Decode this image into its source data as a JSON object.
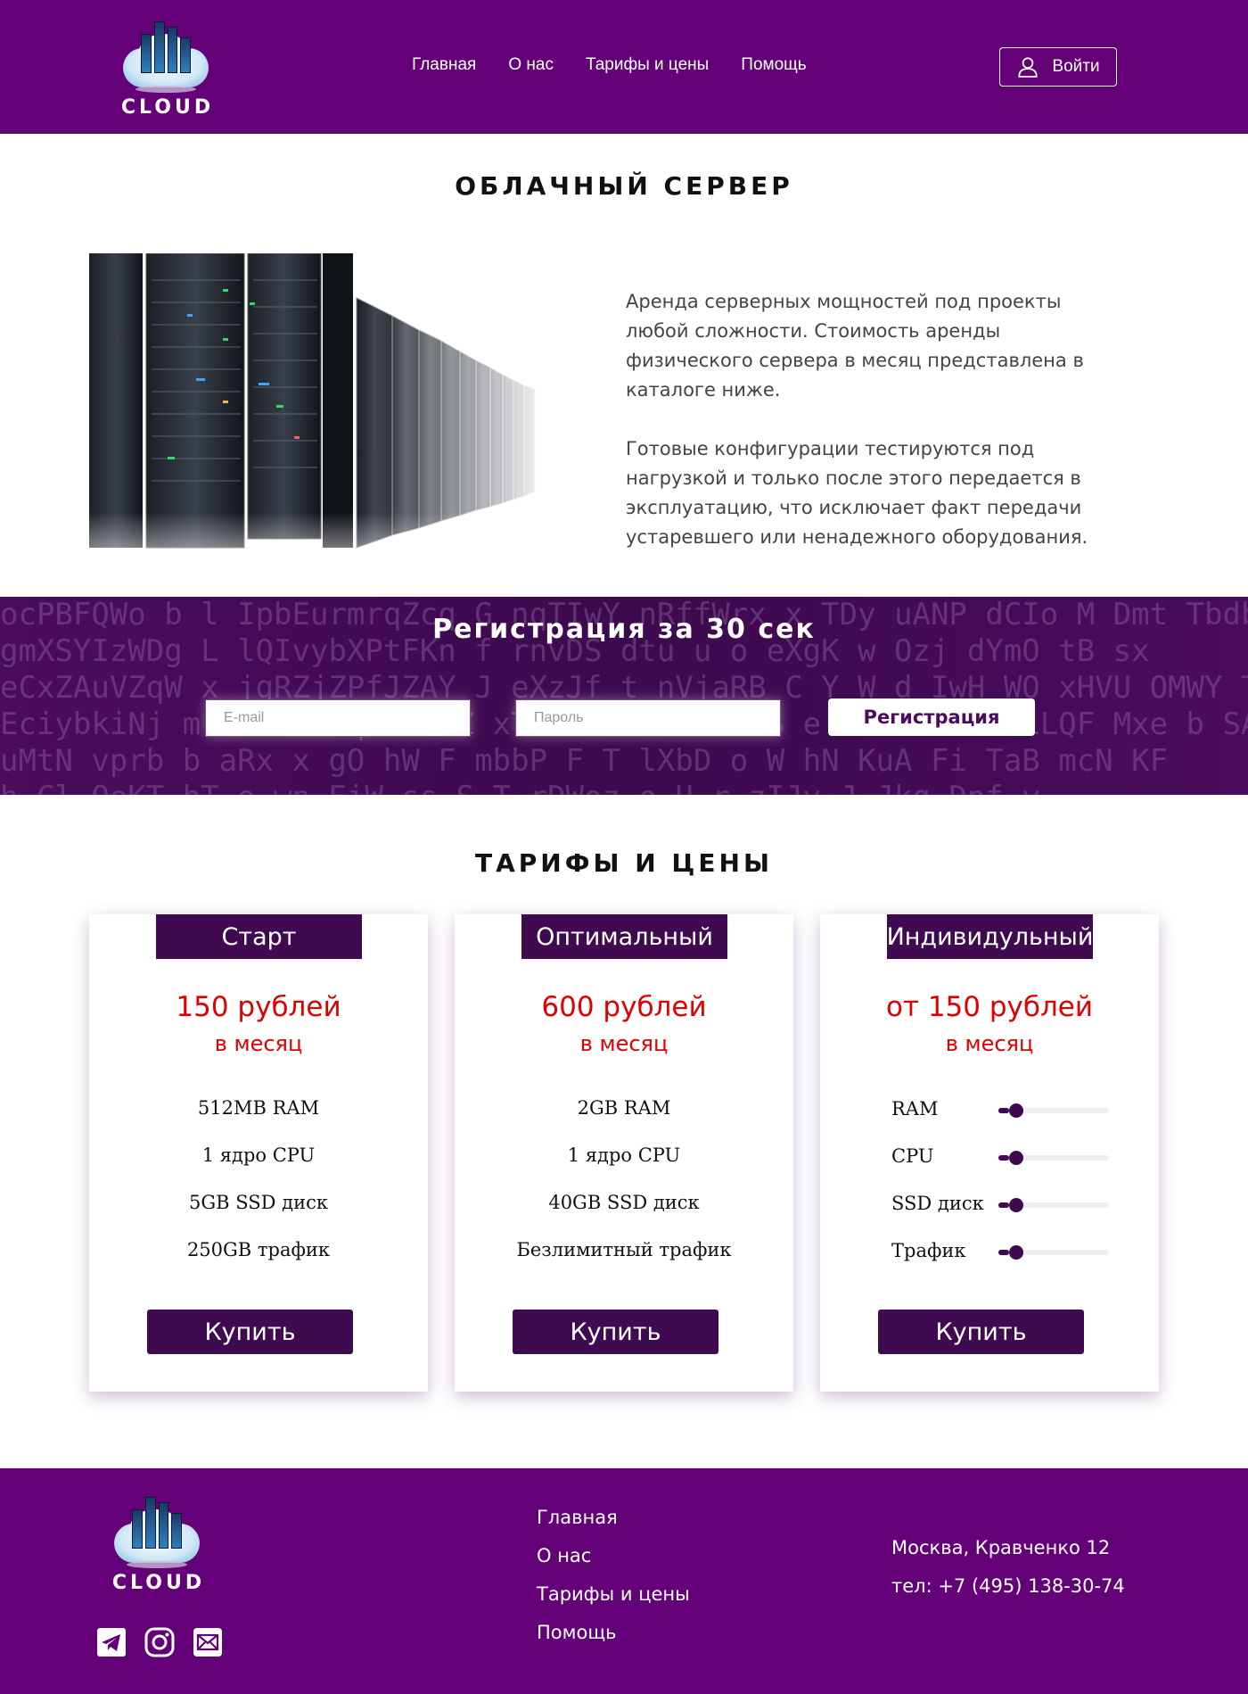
{
  "colors": {
    "brand": "#640078",
    "dark": "#3f0a4f",
    "price": "#e00000"
  },
  "brand": {
    "logo_text": "CLOUD"
  },
  "nav": {
    "items": [
      "Главная",
      "О нас",
      "Тарифы и цены",
      "Помощь"
    ],
    "login_label": "Войти"
  },
  "hero": {
    "title": "ОБЛАЧНЫЙ СЕРВЕР",
    "paragraph_1": "Аренда серверных мощностей под проекты любой сложности. Стоимость аренды физического сервера в месяц представлена в каталоге ниже.",
    "paragraph_2": "Готовые конфигурации тестируются под нагрузкой и только после этого передается в эксплуатацию, что исключает факт передачи устаревшего или ненадежного оборудования."
  },
  "registration": {
    "title": "Регистрация за 30 сек",
    "email_placeholder": "E-mail",
    "password_placeholder": "Пароль",
    "submit_label": "Регистрация"
  },
  "pricing": {
    "title": "ТАРИФЫ И ЦЕНЫ",
    "plans": [
      {
        "name": "Старт",
        "price": "150 рублей",
        "period": "в месяц",
        "features": [
          "512MB RAM",
          "1 ядро CPU",
          "5GB SSD диск",
          "250GB трафик"
        ],
        "buy_label": "Купить"
      },
      {
        "name": "Оптимальный",
        "price": "600 рублей",
        "period": "в месяц",
        "features": [
          "2GB RAM",
          "1 ядро CPU",
          "40GB SSD диск",
          "Безлимитный трафик"
        ],
        "buy_label": "Купить"
      },
      {
        "name": "Индивидульный",
        "price": "от 150 рублей",
        "period": "в месяц",
        "sliders": [
          {
            "label": "RAM",
            "level": 0.1
          },
          {
            "label": "CPU",
            "level": 0.1
          },
          {
            "label": "SSD диск",
            "level": 0.1
          },
          {
            "label": "Трафик",
            "level": 0.1
          }
        ],
        "buy_label": "Купить"
      }
    ]
  },
  "footer": {
    "logo_text": "CLOUD",
    "nav": [
      "Главная",
      "О нас",
      "Тарифы и цены",
      "Помощь"
    ],
    "address": "Москва, Кравченко 12",
    "phone": "тел: +7 (495) 138-30-74",
    "social_icons": [
      "telegram-icon",
      "instagram-icon",
      "mail-icon"
    ]
  }
}
